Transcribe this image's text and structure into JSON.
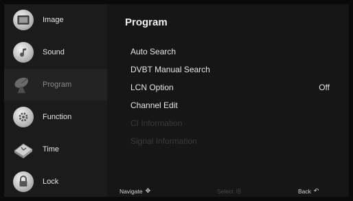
{
  "sidebar": {
    "items": [
      {
        "label": "Image",
        "icon": "image-icon",
        "active": false
      },
      {
        "label": "Sound",
        "icon": "music-note-icon",
        "active": false
      },
      {
        "label": "Program",
        "icon": "satellite-dish-icon",
        "active": true
      },
      {
        "label": "Function",
        "icon": "gear-icon",
        "active": false
      },
      {
        "label": "Time",
        "icon": "clock-icon",
        "active": false
      },
      {
        "label": "Lock",
        "icon": "padlock-icon",
        "active": false
      }
    ]
  },
  "main": {
    "title": "Program",
    "items": [
      {
        "label": "Auto Search",
        "value": "",
        "enabled": true
      },
      {
        "label": "DVBT Manual Search",
        "value": "",
        "enabled": true
      },
      {
        "label": "LCN Option",
        "value": "Off",
        "enabled": true
      },
      {
        "label": "Channel Edit",
        "value": "",
        "enabled": true
      },
      {
        "label": "CI Information",
        "value": "",
        "enabled": false
      },
      {
        "label": "Signal Information",
        "value": "",
        "enabled": false
      }
    ]
  },
  "footer": {
    "navigate": "Navigate",
    "select": "Select",
    "back": "Back"
  },
  "colors": {
    "background": "#151515",
    "sidebar": "#1b1b1b",
    "text": "#e6e6e6",
    "disabled": "#3a3a3a"
  }
}
